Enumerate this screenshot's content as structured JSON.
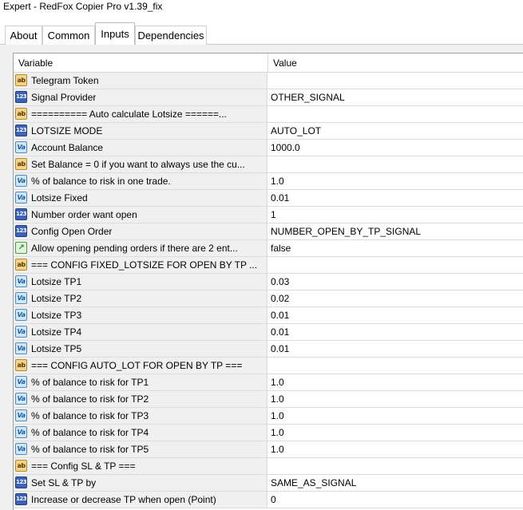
{
  "window": {
    "title": "Expert - RedFox Copier Pro v1.39_fix"
  },
  "tabs": [
    {
      "label": "About"
    },
    {
      "label": "Common"
    },
    {
      "label": "Inputs"
    },
    {
      "label": "Dependencies"
    }
  ],
  "grid": {
    "columns": {
      "variable": "Variable",
      "value": "Value"
    },
    "rows": [
      {
        "icon": "ab",
        "variable": "Telegram Token",
        "value": ""
      },
      {
        "icon": "123",
        "variable": "Signal Provider",
        "value": "OTHER_SIGNAL"
      },
      {
        "icon": "ab",
        "variable": "========== Auto calculate Lotsize ======...",
        "value": ""
      },
      {
        "icon": "123",
        "variable": "LOTSIZE MODE",
        "value": "AUTO_LOT"
      },
      {
        "icon": "Va",
        "variable": "Account Balance",
        "value": "1000.0"
      },
      {
        "icon": "ab",
        "variable": "Set Balance = 0 if you want to always use the cu...",
        "value": ""
      },
      {
        "icon": "Va",
        "variable": "% of balance to risk in one trade.",
        "value": "1.0"
      },
      {
        "icon": "Va",
        "variable": "Lotsize Fixed",
        "value": "0.01"
      },
      {
        "icon": "123",
        "variable": "Number order want open",
        "value": "1"
      },
      {
        "icon": "123",
        "variable": "Config Open Order",
        "value": "NUMBER_OPEN_BY_TP_SIGNAL"
      },
      {
        "icon": "bool",
        "variable": "Allow opening pending orders if there are 2 ent...",
        "value": "false"
      },
      {
        "icon": "ab",
        "variable": "=== CONFIG FIXED_LOTSIZE FOR OPEN BY TP ...",
        "value": ""
      },
      {
        "icon": "Va",
        "variable": "Lotsize TP1",
        "value": "0.03"
      },
      {
        "icon": "Va",
        "variable": "Lotsize TP2",
        "value": "0.02"
      },
      {
        "icon": "Va",
        "variable": "Lotsize TP3",
        "value": "0.01"
      },
      {
        "icon": "Va",
        "variable": "Lotsize TP4",
        "value": "0.01"
      },
      {
        "icon": "Va",
        "variable": "Lotsize TP5",
        "value": "0.01"
      },
      {
        "icon": "ab",
        "variable": "=== CONFIG AUTO_LOT FOR OPEN BY TP ===",
        "value": ""
      },
      {
        "icon": "Va",
        "variable": "% of balance to risk for TP1",
        "value": "1.0"
      },
      {
        "icon": "Va",
        "variable": "% of balance to risk for TP2",
        "value": "1.0"
      },
      {
        "icon": "Va",
        "variable": "% of balance to risk for TP3",
        "value": "1.0"
      },
      {
        "icon": "Va",
        "variable": "% of balance to risk for TP4",
        "value": "1.0"
      },
      {
        "icon": "Va",
        "variable": "% of balance to risk for TP5",
        "value": "1.0"
      },
      {
        "icon": "ab",
        "variable": "=== Config SL & TP ===",
        "value": ""
      },
      {
        "icon": "123",
        "variable": "Set SL & TP by",
        "value": "SAME_AS_SIGNAL"
      },
      {
        "icon": "123",
        "variable": "Increase or decrease TP when open (Point)",
        "value": "0"
      }
    ]
  }
}
